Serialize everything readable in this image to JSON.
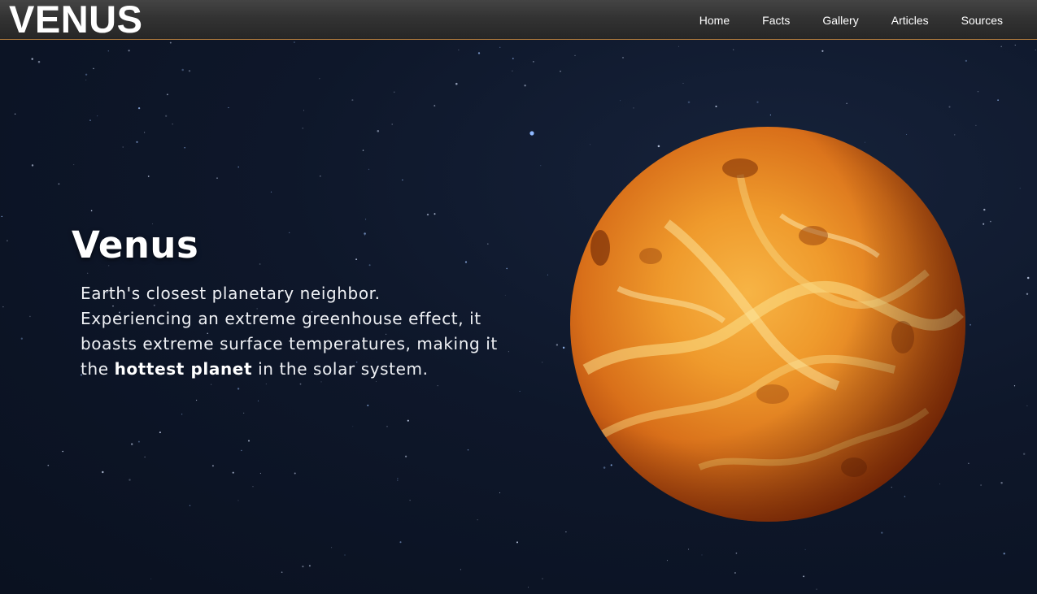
{
  "header": {
    "logo": "VENUS",
    "nav": [
      {
        "label": "Home"
      },
      {
        "label": "Facts"
      },
      {
        "label": "Gallery"
      },
      {
        "label": "Articles"
      },
      {
        "label": "Sources"
      }
    ]
  },
  "hero": {
    "title": "Venus",
    "line1": "Earth's closest planetary neighbor.",
    "line2": "Experiencing an extreme greenhouse effect, it",
    "line3": "boasts extreme surface temperatures, making it",
    "line4_before": "the ",
    "line4_bold": "hottest planet",
    "line4_after": " in the solar system."
  },
  "colors": {
    "nav_background": "#333333",
    "nav_border": "#b07a3c",
    "space_background": "#0e172a",
    "planet_core": "#f39a2a",
    "planet_edge": "#b8440c"
  }
}
